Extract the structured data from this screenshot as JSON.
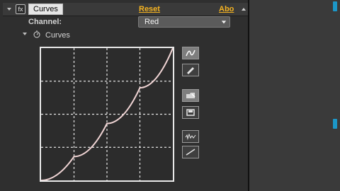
{
  "header": {
    "effect_name": "Curves",
    "fx_glyph": "fx",
    "reset_label": "Reset",
    "about_label": "Abo"
  },
  "controls": {
    "channel_label": "Channel:",
    "channel_value": "Red",
    "curves_label": "Curves"
  },
  "curve": {
    "points": [
      [
        0,
        0
      ],
      [
        0.25,
        0.18
      ],
      [
        0.5,
        0.43
      ],
      [
        0.75,
        0.7
      ],
      [
        1,
        1
      ]
    ],
    "line_color": "#f1d5d5",
    "grid_color": "#e6e6e6"
  },
  "colors": {
    "accent_orange": "#f5b321",
    "accent_blue": "#1c97c8"
  },
  "icons": {
    "curve_tool": "curve-tool-icon",
    "pencil_tool": "pencil-tool-icon",
    "open": "open-folder-icon",
    "save": "save-icon",
    "smooth": "smooth-icon",
    "reset_line": "reset-line-icon"
  }
}
